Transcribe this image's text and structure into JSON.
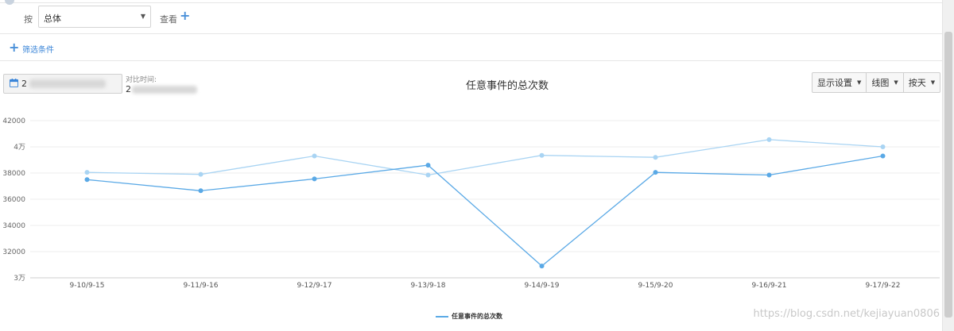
{
  "filter_bar": {
    "by_label": "按",
    "select_value": "总体",
    "view_label": "查看"
  },
  "filter_conditions": {
    "label": "筛选条件"
  },
  "date_range": {
    "value": "2",
    "compare_label": "对比时间:",
    "compare_value": "2"
  },
  "toolbar": {
    "display_settings": "显示设置",
    "chart_type": "线图",
    "granularity": "按天"
  },
  "watermark": "https://blog.csdn.net/kejiayuan0806",
  "colors": {
    "series_primary": "#5aa9e6",
    "series_compare": "#a9d4f3",
    "accent": "#3a85d8"
  },
  "chart_data": {
    "type": "line",
    "title": "任意事件的总次数",
    "categories": [
      "9-10/9-15",
      "9-11/9-16",
      "9-12/9-17",
      "9-13/9-18",
      "9-14/9-19",
      "9-15/9-20",
      "9-16/9-21",
      "9-17/9-22"
    ],
    "series": [
      {
        "name": "任意事件的总次数",
        "values": [
          37500,
          36650,
          37550,
          38600,
          30900,
          38050,
          37850,
          39300
        ]
      },
      {
        "values": [
          38050,
          37900,
          39300,
          37850,
          39350,
          39200,
          40550,
          40000
        ]
      }
    ],
    "y_ticks": [
      "3万",
      "32000",
      "34000",
      "36000",
      "38000",
      "4万",
      "42000"
    ],
    "ylim": [
      30000,
      42000
    ],
    "legend": "bottom-center",
    "grid": true
  }
}
